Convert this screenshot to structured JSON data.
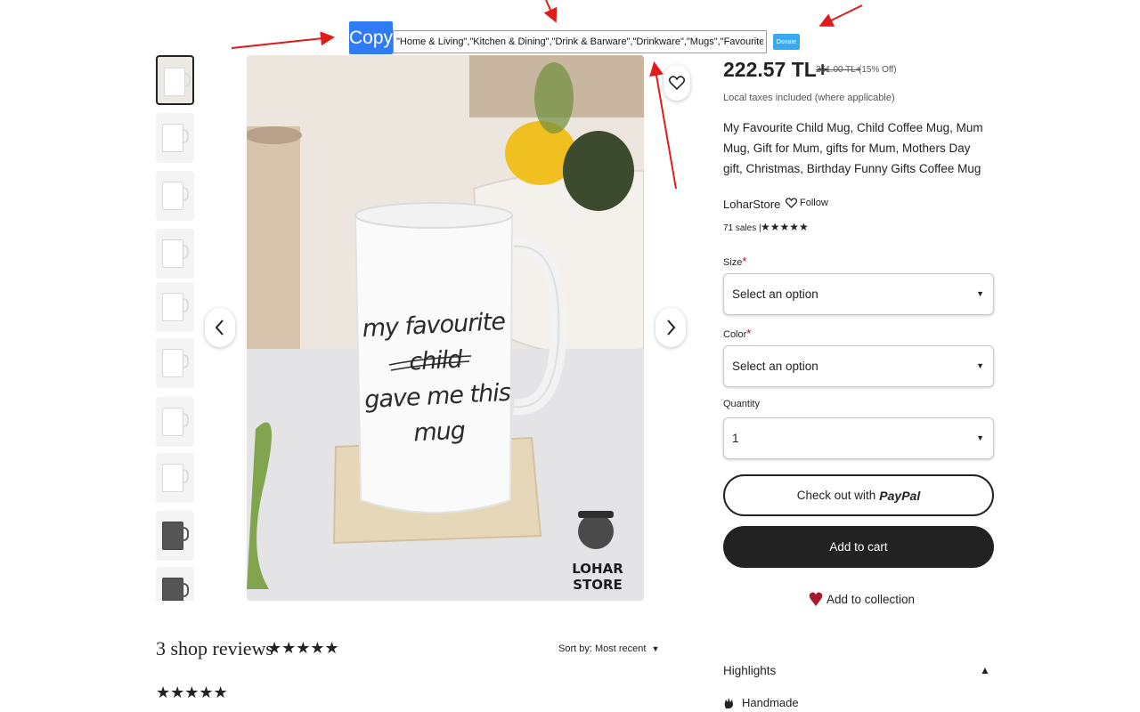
{
  "extension": {
    "copy_label": "Copy",
    "tags_value": "\"Home & Living\",\"Kitchen & Dining\",\"Drink & Barware\",\"Drinkware\",\"Mugs\",\"Favourite child mug\",\"funny mug\"",
    "donate_label": "Donate",
    "arrow_color": "#e01b1b"
  },
  "gallery": {
    "thumbnail_count": 10,
    "active_thumbnail": 1,
    "prev_icon": "chevron-left-icon",
    "next_icon": "chevron-right-icon",
    "favorite_icon": "heart-outline-icon",
    "mug_text_line1": "my favourite child",
    "mug_text_line2": "gave me this mug",
    "logo_text": "LOHAR STORE"
  },
  "reviews": {
    "title": "3 shop reviews",
    "stars": "★★★★★",
    "sort_label": "Sort by: Most recent",
    "first_review_stars": "★★★★★"
  },
  "product": {
    "price": "222.57 TL+",
    "original_price": "261.00 TL+",
    "discount": "(15% Off)",
    "tax_note": "Local taxes included (where applicable)",
    "title": "My Favourite Child Mug, Child Coffee Mug, Mum Mug, Gift for Mum, gifts for Mum, Mothers Day gift, Christmas, Birthday Funny Gifts Coffee Mug",
    "shop_name": "LoharStore",
    "follow_label": "Follow",
    "sales": "71 sales",
    "sales_stars": "★★★★★",
    "size_label": "Size",
    "size_placeholder": "Select an option",
    "color_label": "Color",
    "color_placeholder": "Select an option",
    "required_mark": "*",
    "quantity_label": "Quantity",
    "quantity_value": "1",
    "paypal_prefix": "Check out with",
    "paypal_logo": "PayPal",
    "add_to_cart": "Add to cart",
    "add_to_collection": "Add to collection",
    "highlights_title": "Highlights",
    "handmade_label": "Handmade",
    "accent_heart_color": "#a61a2e"
  }
}
